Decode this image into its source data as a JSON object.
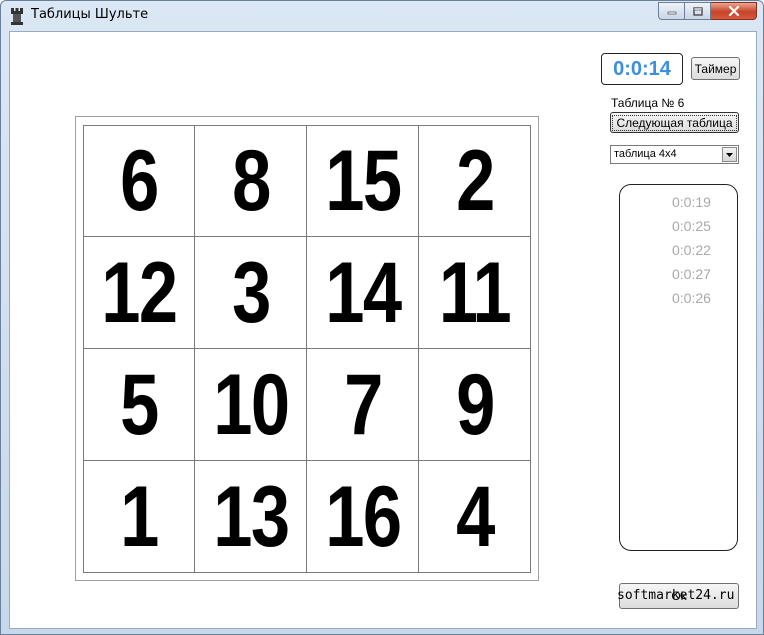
{
  "window": {
    "title": "Таблицы Шульте",
    "icon": "chess-rook-icon"
  },
  "grid": {
    "rows": [
      [
        "6",
        "8",
        "15",
        "2"
      ],
      [
        "12",
        "3",
        "14",
        "11"
      ],
      [
        "5",
        "10",
        "7",
        "9"
      ],
      [
        "1",
        "13",
        "16",
        "4"
      ]
    ]
  },
  "panel": {
    "timer_value": "0:0:14",
    "timer_button": "Таймер",
    "table_label": "Таблица № 6",
    "next_button": "Следующая таблица",
    "table_size_selected": "таблица 4x4",
    "results": [
      "0:0:19",
      "0:0:25",
      "0:0:22",
      "0:0:27",
      "0:0:26"
    ],
    "ok_button": "Ok",
    "watermark": "softmarket24.ru"
  },
  "colors": {
    "timer": "#3c8fe0",
    "results": "#a9a9a9",
    "close_button": "#c7452a"
  }
}
